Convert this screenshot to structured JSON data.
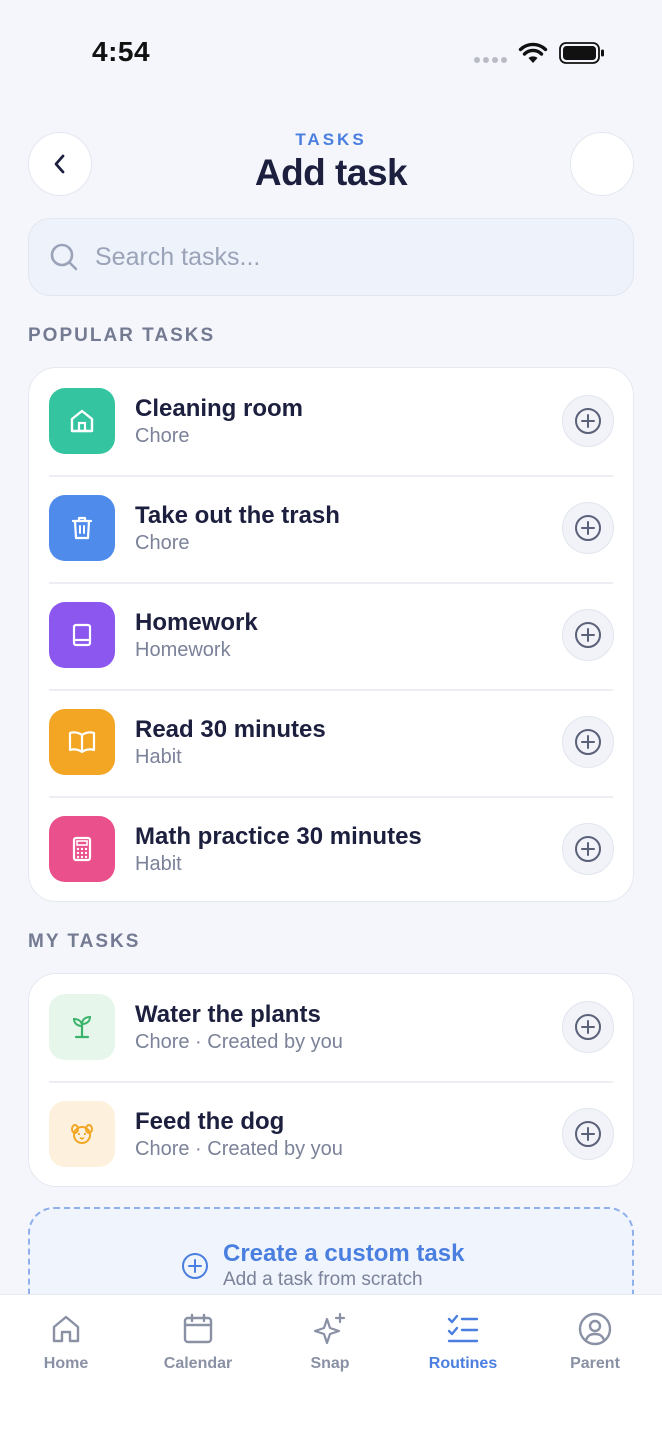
{
  "status_bar": {
    "time": "4:54"
  },
  "header": {
    "eyebrow": "TASKS",
    "title": "Add task"
  },
  "search": {
    "placeholder": "Search tasks..."
  },
  "popular": {
    "title": "POPULAR TASKS",
    "items": [
      {
        "name": "Cleaning room",
        "category": "Chore",
        "icon": "home-icon",
        "color": "#34c5a0"
      },
      {
        "name": "Take out the trash",
        "category": "Chore",
        "icon": "trash-icon",
        "color": "#4f8bea"
      },
      {
        "name": "Homework",
        "category": "Homework",
        "icon": "book-icon",
        "color": "#8b57ef"
      },
      {
        "name": "Read 30 minutes",
        "category": "Habit",
        "icon": "open-book-icon",
        "color": "#f2a623"
      },
      {
        "name": "Math practice 30 minutes",
        "category": "Habit",
        "icon": "calculator-icon",
        "color": "#e9508c"
      }
    ]
  },
  "my_tasks": {
    "title": "MY TASKS",
    "items": [
      {
        "name": "Water the plants",
        "category": "Chore · Created by you",
        "icon": "sprout-icon",
        "color": "#e6f6ea"
      },
      {
        "name": "Feed the dog",
        "category": "Chore · Created by you",
        "icon": "dog-icon",
        "color": "#fdf1de"
      }
    ]
  },
  "custom": {
    "title": "Create a custom task",
    "subtitle": "Add a task from scratch"
  },
  "tabs": [
    {
      "label": "Home",
      "icon": "home-icon"
    },
    {
      "label": "Calendar",
      "icon": "calendar-icon"
    },
    {
      "label": "Snap",
      "icon": "sparkle-icon"
    },
    {
      "label": "Routines",
      "icon": "checklist-icon",
      "active": true
    },
    {
      "label": "Parent",
      "icon": "user-circle-icon"
    }
  ],
  "colors": {
    "accent": "#4a7fe0",
    "title": "#1c1f3d",
    "muted": "#7b8299",
    "background": "#f4f6fb"
  }
}
